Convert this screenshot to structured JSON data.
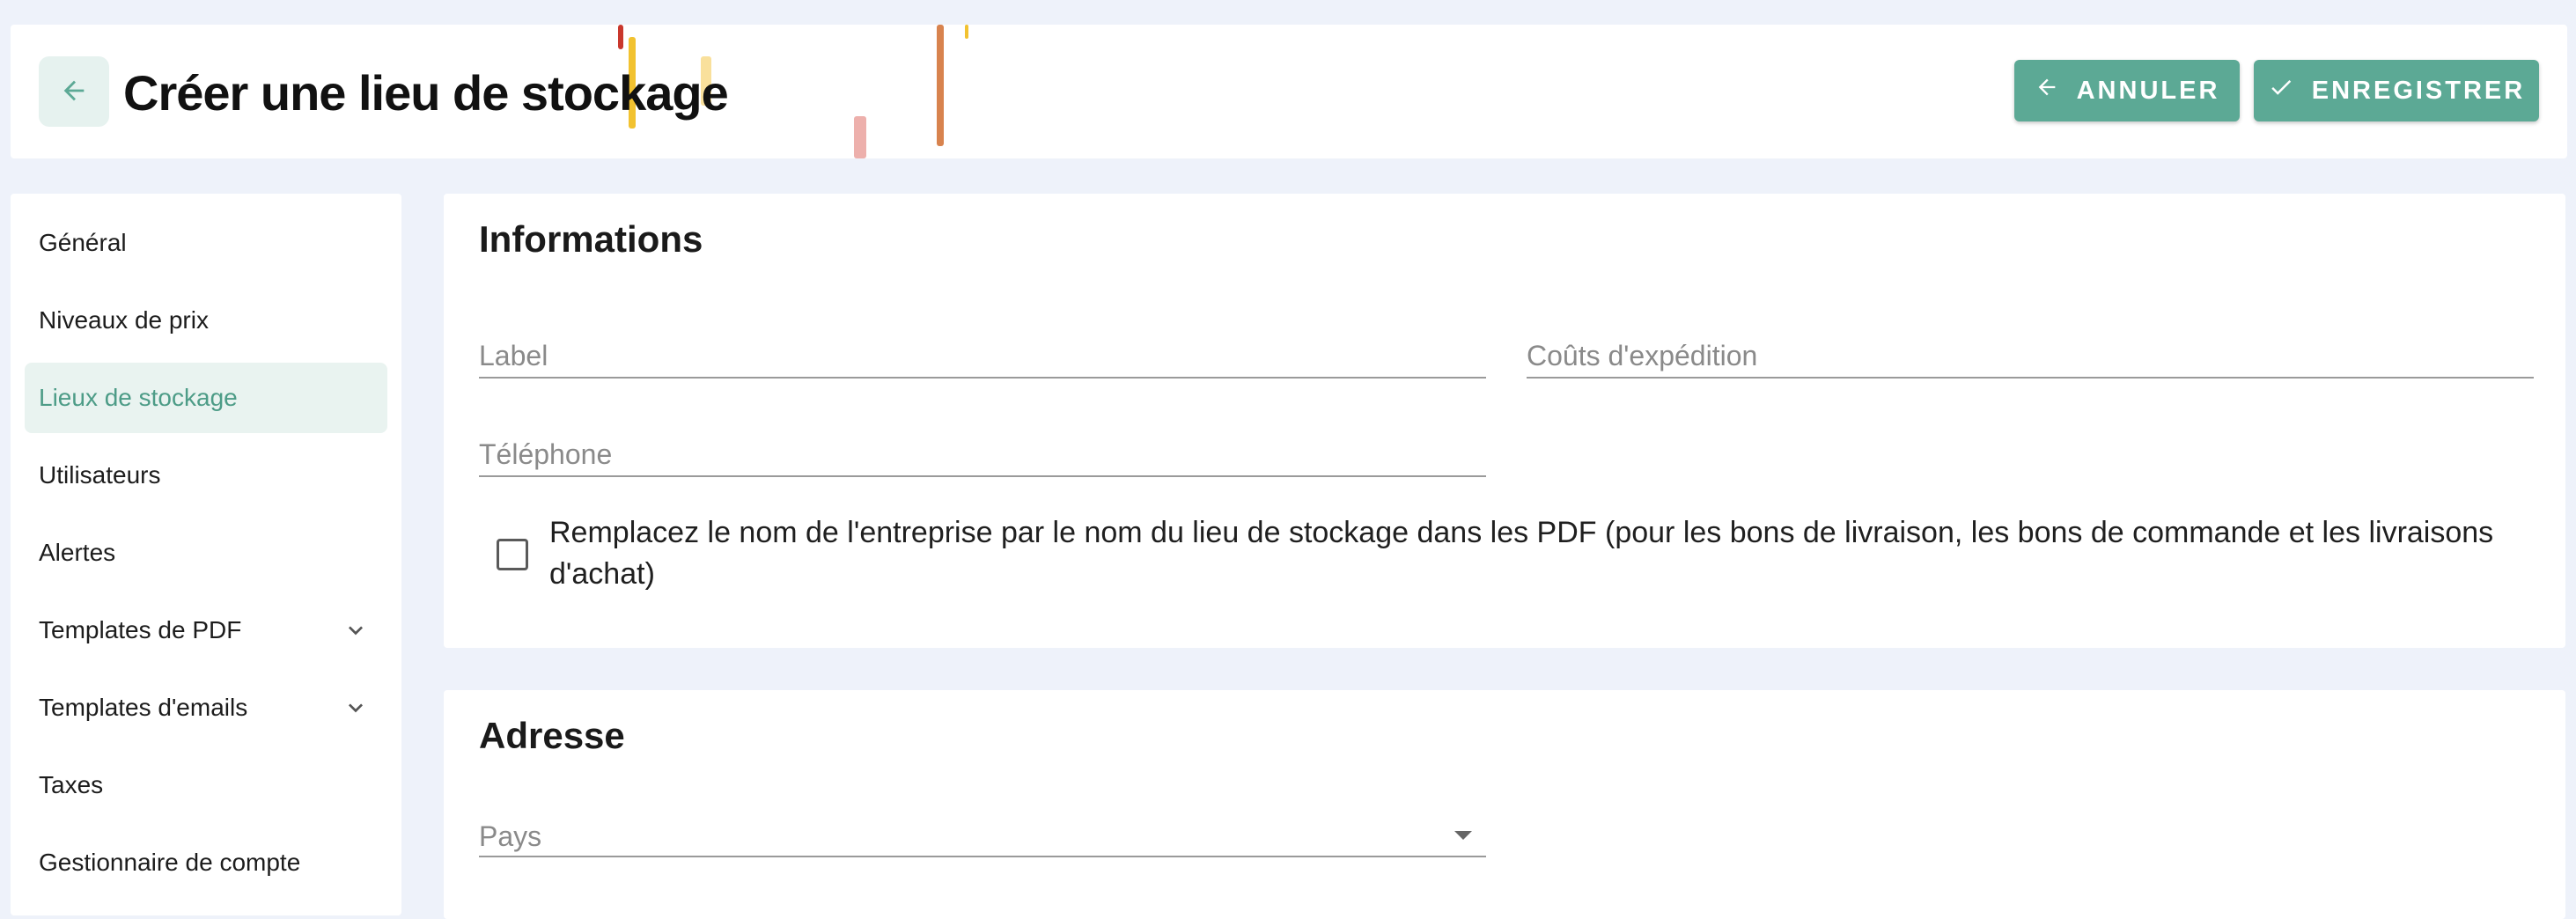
{
  "header": {
    "title": "Créer une lieu de stockage",
    "cancel_label": "ANNULER",
    "save_label": "ENREGISTRER"
  },
  "sidebar": {
    "items": [
      {
        "label": "Général",
        "active": false
      },
      {
        "label": "Niveaux de prix",
        "active": false
      },
      {
        "label": "Lieux de stockage",
        "active": true
      },
      {
        "label": "Utilisateurs",
        "active": false
      },
      {
        "label": "Alertes",
        "active": false
      },
      {
        "label": "Templates de PDF",
        "expandable": true
      },
      {
        "label": "Templates d'emails",
        "expandable": true
      },
      {
        "label": "Taxes",
        "active": false
      },
      {
        "label": "Gestionnaire de compte",
        "active": false
      }
    ]
  },
  "informations": {
    "title": "Informations",
    "label_placeholder": "Label",
    "shipping_cost_placeholder": "Coûts d'expédition",
    "phone_placeholder": "Téléphone",
    "checkbox_label": "Remplacez le nom de l'entreprise par le nom du lieu de stockage dans les PDF (pour les bons de livraison, les bons de commande et les livraisons d'achat)",
    "checkbox_checked": false
  },
  "adresse": {
    "title": "Adresse",
    "country_placeholder": "Pays"
  },
  "colors": {
    "accent": "#5ca995",
    "accent_light": "#e9f3f0",
    "background": "#eef2fa"
  }
}
